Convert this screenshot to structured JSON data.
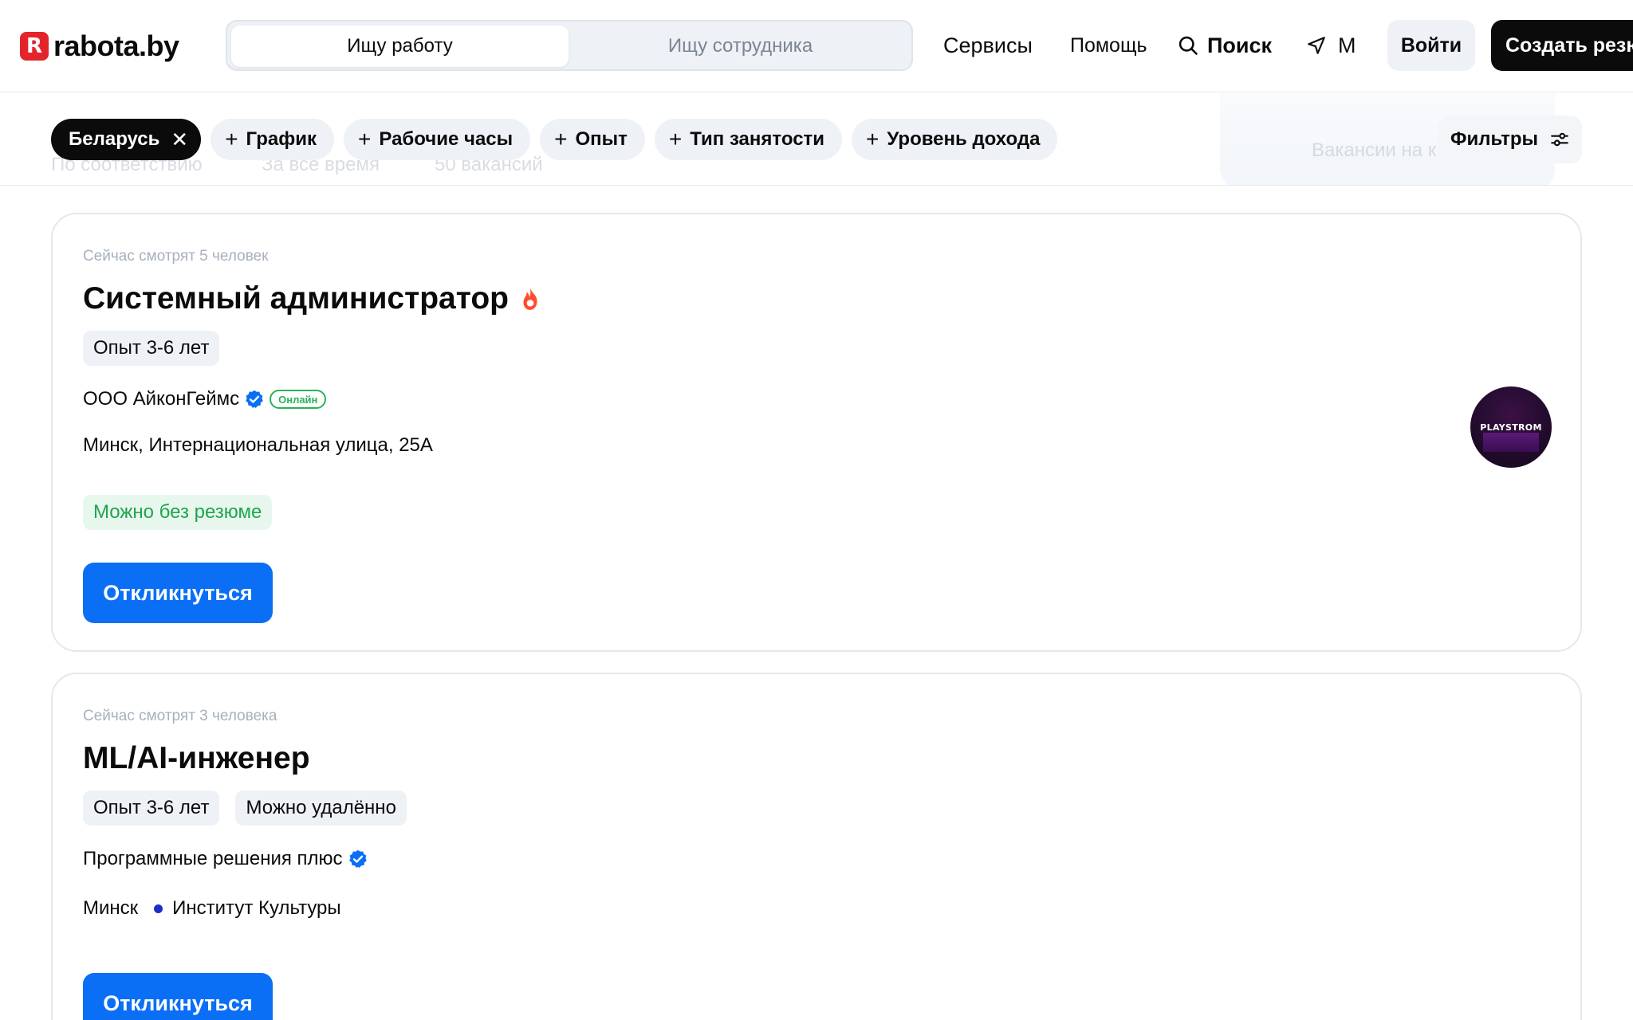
{
  "header": {
    "logo_mark": "R",
    "logo_text": "rabota.by",
    "tab_job": "Ищу работу",
    "tab_employee": "Ищу сотрудника",
    "services": "Сервисы",
    "help": "Помощь",
    "search": "Поиск",
    "location": "М",
    "login": "Войти",
    "create_resume": "Создать резюме"
  },
  "filters": {
    "country_chip": "Беларусь",
    "chip_schedule": "График",
    "chip_hours": "Рабочие часы",
    "chip_experience": "Опыт",
    "chip_employment": "Тип занятости",
    "chip_income": "Уровень дохода",
    "filters_button": "Фильтры",
    "ghost_sort": "По соответствию",
    "ghost_period": "За всё время",
    "ghost_count": "50 вакансий",
    "ghost_map": "Вакансии на к"
  },
  "vacancies": [
    {
      "viewers": "Сейчас смотрят 5 человек",
      "title": "Системный администратор",
      "tags": [
        "Опыт 3-6 лет"
      ],
      "company": "ООО АйконГеймс",
      "online_badge": "Онлайн",
      "address": "Минск, Интернациональная улица, 25А",
      "no_resume": "Можно без резюме",
      "apply": "Откликнуться",
      "logo_text": "PLAYSTROM"
    },
    {
      "viewers": "Сейчас смотрят 3 человека",
      "title": "ML/AI-инженер",
      "tags": [
        "Опыт 3-6 лет",
        "Можно удалённо"
      ],
      "company": "Программные решения плюс",
      "city": "Минск",
      "metro": "Институт Культуры",
      "apply": "Откликнуться"
    }
  ],
  "colors": {
    "brand_red": "#e3242b",
    "primary_blue": "#0a6ff5",
    "success_green": "#1fa54d",
    "metro_blue": "#1a2fc9"
  }
}
